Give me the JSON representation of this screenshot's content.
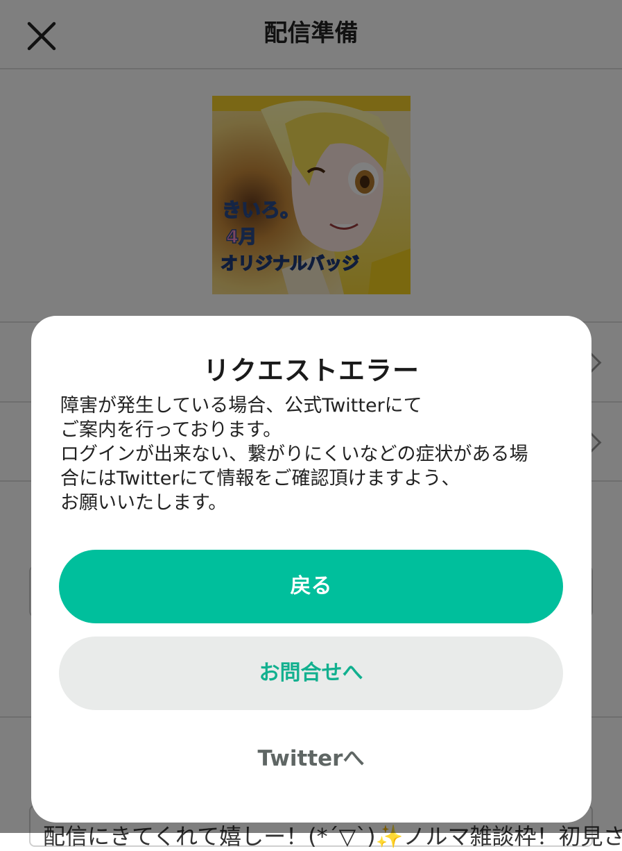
{
  "header": {
    "title": "配信準備"
  },
  "background": {
    "thumbnail": {
      "caption_line1": "きいろ。",
      "caption_line2": "4月",
      "caption_line3": "オリジナルバッジ"
    },
    "field_text": "配信にきてくれて嬉しー！(*´▽`)✨ノルマ雑談枠！初見さ"
  },
  "dialog": {
    "title": "リクエストエラー",
    "message_lines": [
      "障害が発生している場合、公式Twitterにて",
      "ご案内を行っております。",
      "ログインが出来ない、繋がりにくいなどの症状がある場",
      "合にはTwitterにて情報をご確認頂けますよう、",
      "お願いいたします。"
    ],
    "primary_button": "戻る",
    "secondary_button": "お問合せへ",
    "text_button": "Twitterへ"
  },
  "colors": {
    "accent": "#00bf9c",
    "secondary_bg": "#e9ebea",
    "secondary_text": "#12b08f",
    "overlay": "rgba(0,0,0,0.5)"
  }
}
